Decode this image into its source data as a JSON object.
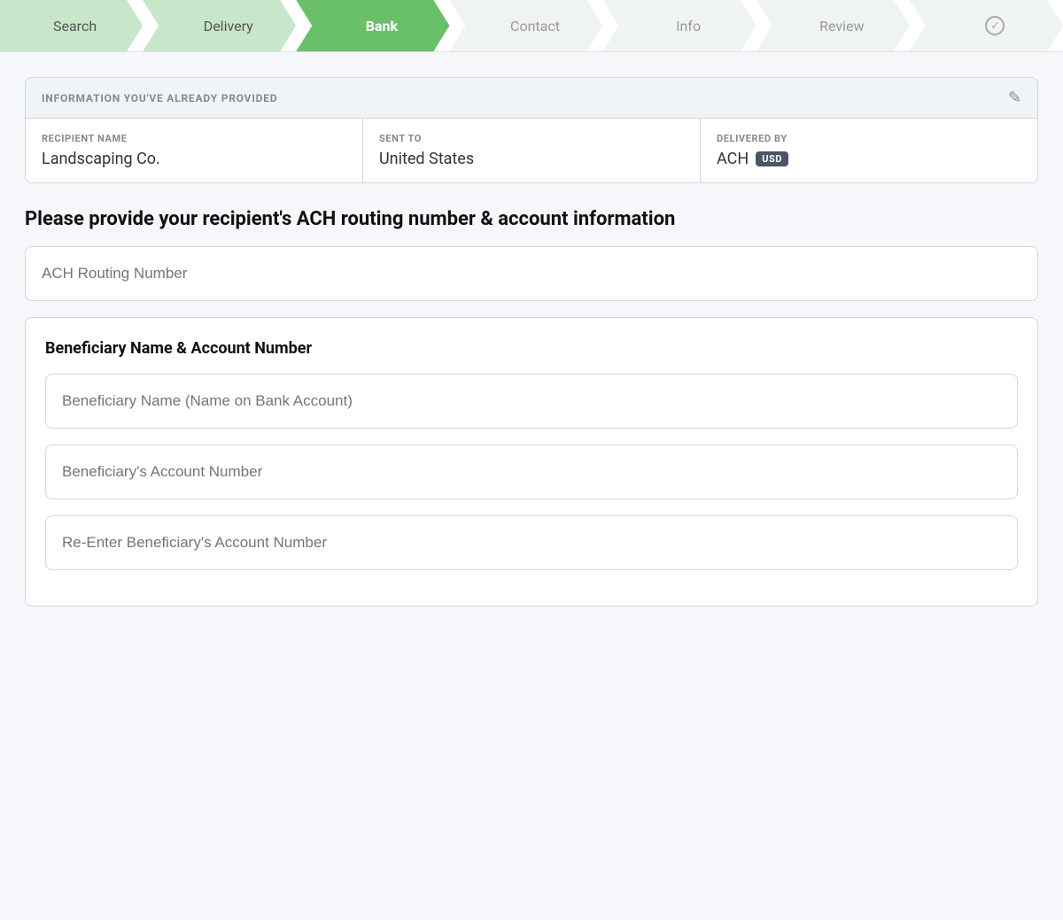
{
  "stepper": {
    "steps": [
      {
        "id": "search",
        "label": "Search",
        "state": "completed"
      },
      {
        "id": "delivery",
        "label": "Delivery",
        "state": "completed"
      },
      {
        "id": "bank",
        "label": "Bank",
        "state": "active"
      },
      {
        "id": "contact",
        "label": "Contact",
        "state": "inactive"
      },
      {
        "id": "info",
        "label": "Info",
        "state": "inactive"
      },
      {
        "id": "review",
        "label": "Review",
        "state": "inactive"
      },
      {
        "id": "done",
        "label": "✓",
        "state": "inactive"
      }
    ]
  },
  "info_card": {
    "header": "INFORMATION YOU'VE ALREADY PROVIDED",
    "edit_icon": "✎",
    "cells": [
      {
        "label": "RECIPIENT NAME",
        "value": "Landscaping Co."
      },
      {
        "label": "SENT TO",
        "value": "United States"
      },
      {
        "label": "DELIVERED BY",
        "value": "ACH",
        "badge": "USD"
      }
    ]
  },
  "main": {
    "heading": "Please provide your recipient's ACH routing number & account information",
    "routing_placeholder": "ACH Routing Number",
    "sub_card": {
      "title": "Beneficiary Name & Account Number",
      "fields": [
        {
          "placeholder": "Beneficiary Name (Name on Bank Account)"
        },
        {
          "placeholder": "Beneficiary's Account Number"
        },
        {
          "placeholder": "Re-Enter Beneficiary's Account Number"
        }
      ]
    }
  }
}
